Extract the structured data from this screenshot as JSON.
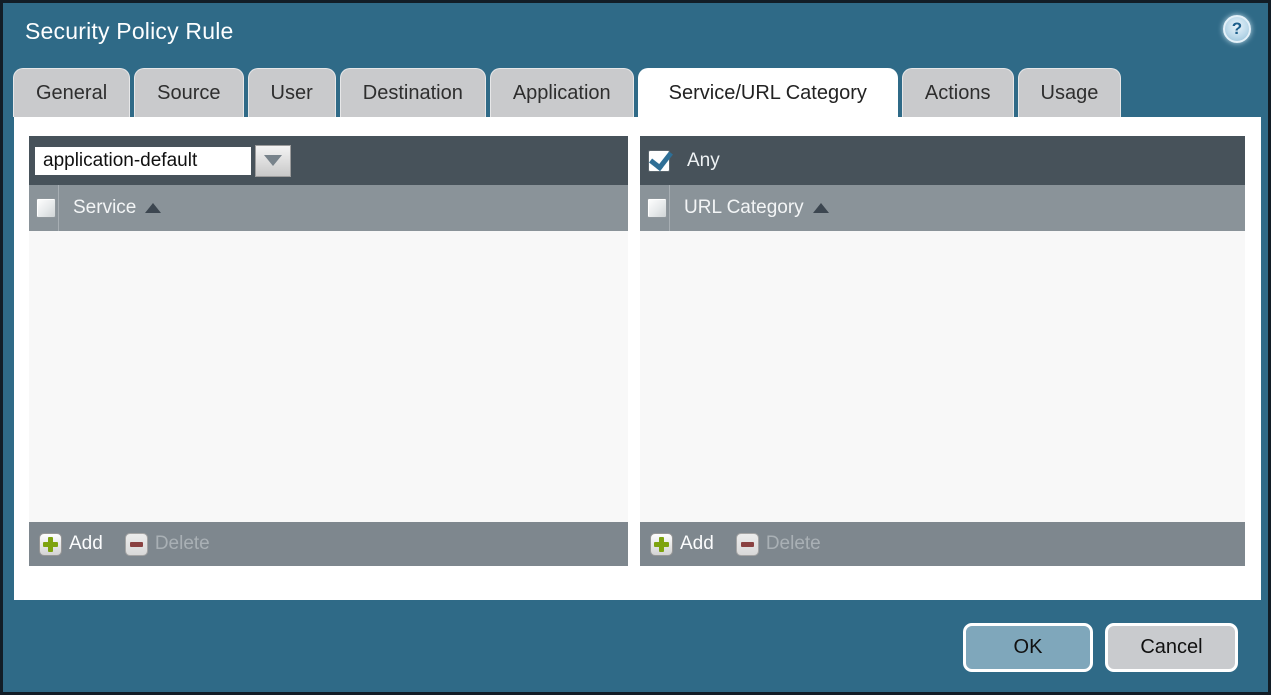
{
  "window": {
    "title": "Security Policy Rule"
  },
  "icons": {
    "help": "?"
  },
  "tabs": [
    {
      "label": "General",
      "active": false
    },
    {
      "label": "Source",
      "active": false
    },
    {
      "label": "User",
      "active": false
    },
    {
      "label": "Destination",
      "active": false
    },
    {
      "label": "Application",
      "active": false
    },
    {
      "label": "Service/URL Category",
      "active": true
    },
    {
      "label": "Actions",
      "active": false
    },
    {
      "label": "Usage",
      "active": false
    }
  ],
  "service_panel": {
    "dropdown_value": "application-default",
    "column_header": "Service",
    "sort_order": "asc",
    "select_all_checked": false,
    "rows": [],
    "add_label": "Add",
    "delete_label": "Delete",
    "delete_enabled": false
  },
  "url_category_panel": {
    "any_label": "Any",
    "any_checked": true,
    "column_header": "URL Category",
    "sort_order": "asc",
    "select_all_checked": false,
    "rows": [],
    "add_label": "Add",
    "delete_label": "Delete",
    "delete_enabled": false
  },
  "dialog_buttons": {
    "ok": "OK",
    "cancel": "Cancel"
  },
  "colors": {
    "background": "#2f6a87",
    "window_border": "#121d26",
    "panel_header": "#47525a",
    "column_header": "#8a9399",
    "panel_footer": "#7e878e",
    "panel_body": "#f8f8f8",
    "tab": "#c9cacc",
    "active_tab": "#ffffff",
    "ok_button": "#7fa7bb",
    "cancel_button": "#c9cbce",
    "add_plus": "#7ea30f",
    "delete_minus": "#8a4141",
    "checkmark": "#2e6f96"
  }
}
